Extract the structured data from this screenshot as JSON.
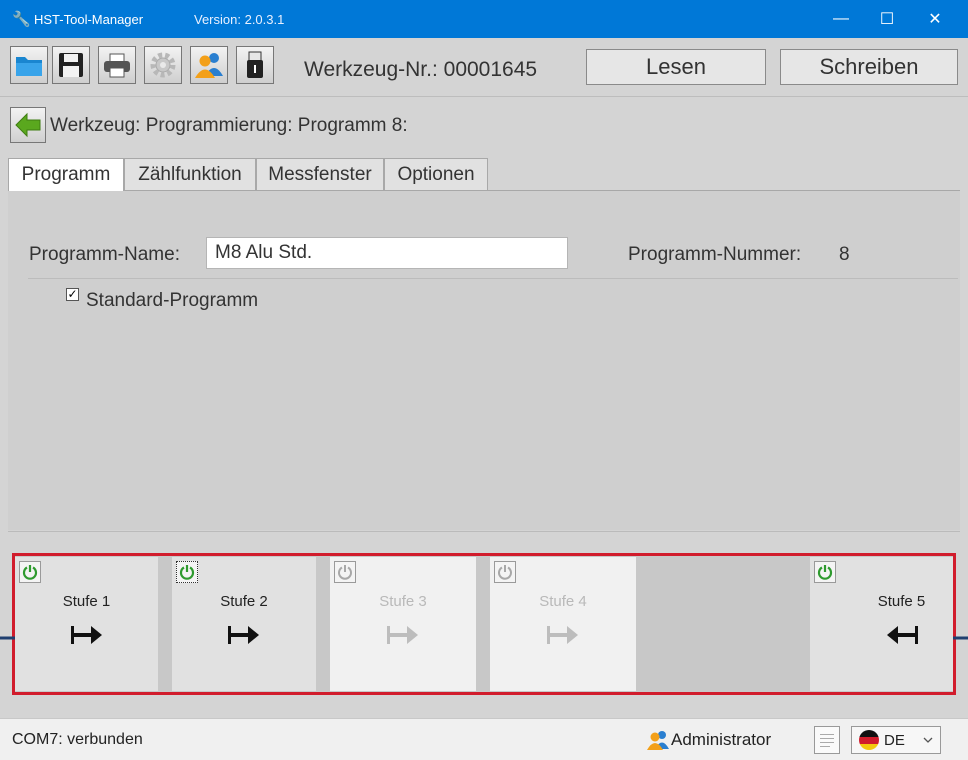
{
  "window": {
    "title": "HST-Tool-Manager",
    "version": "Version: 2.0.3.1",
    "minimize_glyph": "—",
    "maximize_glyph": "☐",
    "close_glyph": "✕"
  },
  "toolbar": {
    "icons": [
      "open-folder-icon",
      "save-icon",
      "print-icon",
      "settings-gear-icon",
      "users-icon",
      "usb-drive-icon"
    ],
    "tool_number_label": "Werkzeug-Nr.: 00001645",
    "read_button": "Lesen",
    "write_button": "Schreiben"
  },
  "breadcrumb": {
    "text": "Werkzeug: Programmierung: Programm 8:"
  },
  "tabs": [
    {
      "label": "Programm",
      "active": true
    },
    {
      "label": "Zählfunktion",
      "active": false
    },
    {
      "label": "Messfenster",
      "active": false
    },
    {
      "label": "Optionen",
      "active": false
    }
  ],
  "program": {
    "name_label": "Programm-Name:",
    "name_value": "M8 Alu Std.",
    "number_label": "Programm-Nummer:",
    "number_value": "8",
    "standard_label": "Standard-Programm",
    "standard_checked": true,
    "check_glyph": "✓"
  },
  "stages": [
    {
      "label": "Stufe 1",
      "enabled": true,
      "direction": "right"
    },
    {
      "label": "Stufe 2",
      "enabled": true,
      "direction": "right"
    },
    {
      "label": "Stufe 3",
      "enabled": false,
      "direction": "right"
    },
    {
      "label": "Stufe 4",
      "enabled": false,
      "direction": "right"
    },
    {
      "label": "Stufe 5",
      "enabled": true,
      "direction": "left"
    }
  ],
  "status": {
    "connection": "COM7: verbunden",
    "user": "Administrator",
    "language": "DE",
    "language_flag": "de-flag-icon"
  },
  "colors": {
    "title_bar": "#0078d7",
    "highlight_border": "#d11c2c",
    "power_on": "#2e9a2e",
    "power_off": "#a8a8a8",
    "external_arrow": "#1f3f70"
  }
}
